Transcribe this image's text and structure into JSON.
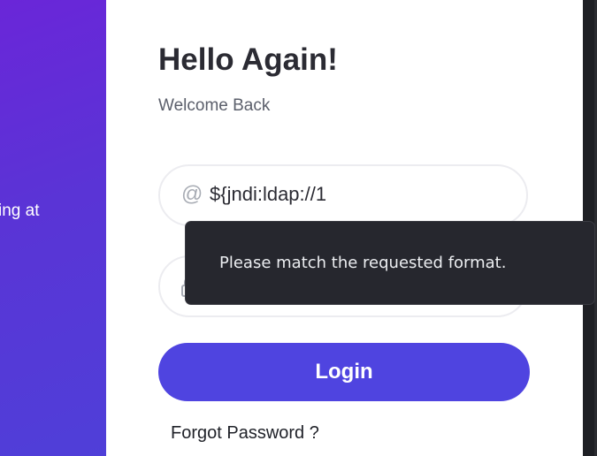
{
  "left_panel": {
    "text": "ing at"
  },
  "login_form": {
    "heading": "Hello Again!",
    "subheading": "Welcome Back",
    "email": {
      "icon": "at-icon",
      "value": "${jndi:ldap://1",
      "placeholder": ""
    },
    "password": {
      "icon": "lock-icon",
      "value": ""
    },
    "login_label": "Login",
    "forgot_label": "Forgot Password ?"
  },
  "validation_tooltip": {
    "message": "Please match the requested format."
  },
  "colors": {
    "gradient_start": "#6a26d8",
    "gradient_end": "#4f3fd8",
    "button_bg": "#4f44e0",
    "tooltip_bg": "#26272e",
    "heading_text": "#2b2b33"
  }
}
